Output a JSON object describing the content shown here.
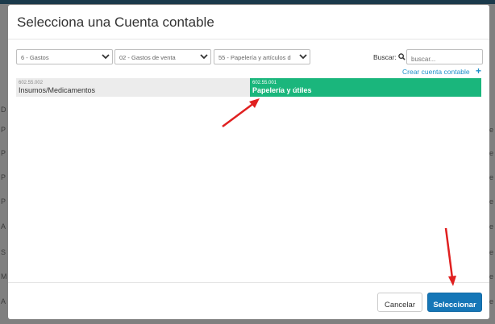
{
  "background": {
    "left_letters": [
      "D",
      "P",
      "P",
      "P",
      "P",
      "A",
      "S",
      "M",
      "A"
    ],
    "right_letters": [
      "s",
      "e",
      "e",
      "e",
      "e",
      "e",
      "e",
      "e",
      "e"
    ]
  },
  "modal": {
    "title": "Selecciona una Cuenta contable"
  },
  "filters": {
    "level1": "6 - Gastos",
    "level2": "02 - Gastos de venta",
    "level3": "55 - Papelería y artículos d"
  },
  "search": {
    "label": "Buscar:",
    "placeholder": "buscar..."
  },
  "create_account": {
    "label": "Crear cuenta contable",
    "icon": "+"
  },
  "accounts": [
    {
      "code": "602.55.002",
      "name": "Insumos/Medicamentos",
      "selected": false
    },
    {
      "code": "602.55.001",
      "name": "Papelería y útiles",
      "selected": true
    }
  ],
  "footer": {
    "cancel_label": "Cancelar",
    "select_label": "Seleccionar"
  },
  "colors": {
    "selected_account": "#1ab67c",
    "primary_button": "#1576b7",
    "link": "#1f8fc9",
    "annotation_arrow": "#e02020"
  }
}
